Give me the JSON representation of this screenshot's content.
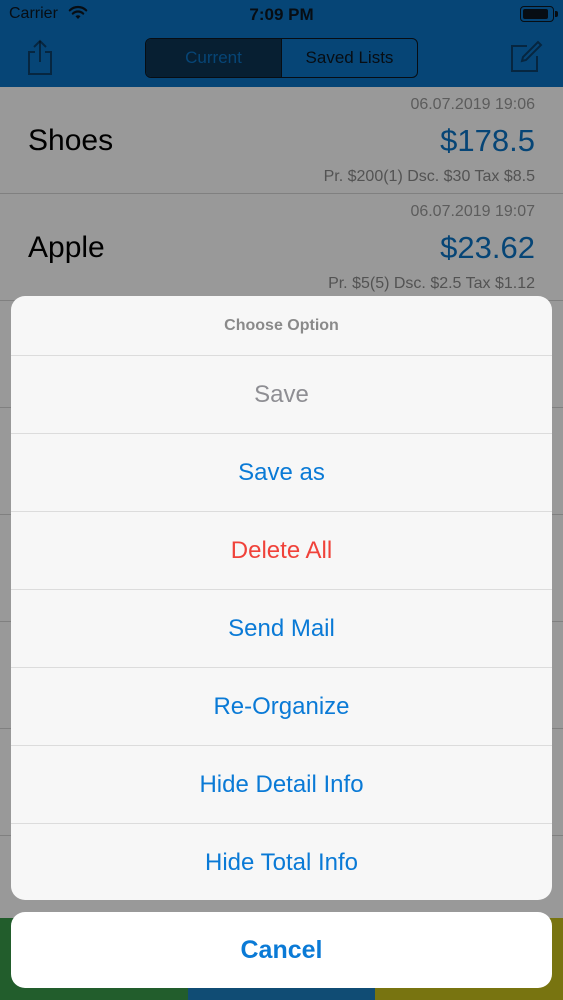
{
  "status_bar": {
    "carrier": "Carrier",
    "time": "7:09 PM",
    "battery_level": 0.92
  },
  "nav": {
    "segments": [
      {
        "label": "Current",
        "selected": true
      },
      {
        "label": "Saved Lists",
        "selected": false
      }
    ],
    "left_icon": "share-icon",
    "right_icon": "compose-icon"
  },
  "list": {
    "items": [
      {
        "date": "06.07.2019 19:06",
        "name": "Shoes",
        "price": "$178.5",
        "detail": "Pr. $200(1) Dsc. $30 Tax $8.5"
      },
      {
        "date": "06.07.2019 19:07",
        "name": "Apple",
        "price": "$23.62",
        "detail": "Pr. $5(5) Dsc. $2.5 Tax $1.12"
      }
    ]
  },
  "action_sheet": {
    "title": "Choose Option",
    "options": [
      {
        "label": "Save",
        "style": "disabled"
      },
      {
        "label": "Save as",
        "style": "default"
      },
      {
        "label": "Delete All",
        "style": "destructive"
      },
      {
        "label": "Send Mail",
        "style": "default"
      },
      {
        "label": "Re-Organize",
        "style": "default"
      },
      {
        "label": "Hide Detail Info",
        "style": "default"
      },
      {
        "label": "Hide Total Info",
        "style": "default"
      }
    ],
    "cancel_label": "Cancel"
  },
  "colors": {
    "brand_blue": "#0a73c5",
    "action_blue": "#0a7ad6",
    "destructive_red": "#f0423a",
    "disabled_gray": "#8e8e93"
  }
}
